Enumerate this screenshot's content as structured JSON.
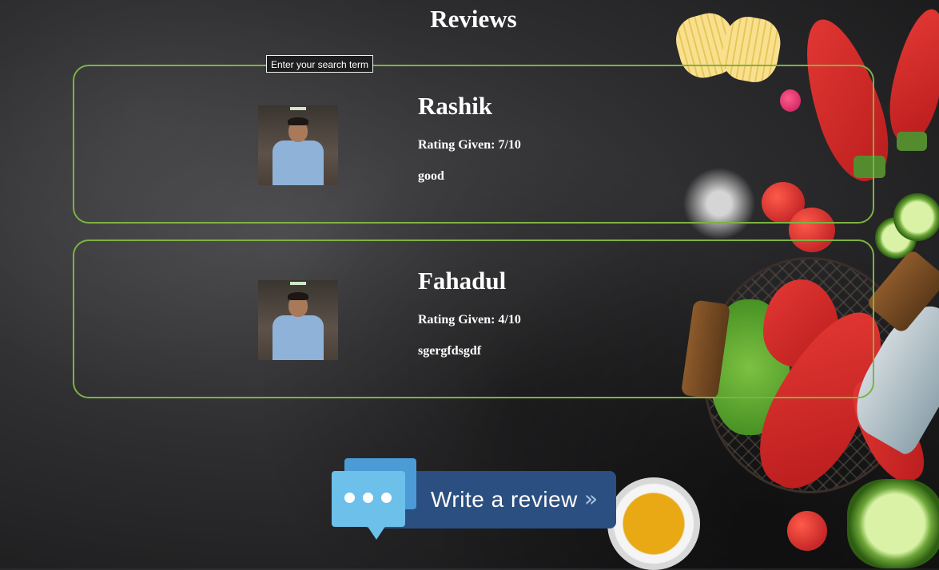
{
  "page": {
    "title": "Reviews"
  },
  "search": {
    "tooltip": "Enter your search term"
  },
  "reviews": [
    {
      "name": "Rashik",
      "rating": "Rating Given: 7/10",
      "comment": "good"
    },
    {
      "name": "Fahadul",
      "rating": "Rating Given: 4/10",
      "comment": "sgergfdsgdf"
    }
  ],
  "write_review": {
    "label": "Write a review",
    "arrow": "»"
  },
  "colors": {
    "card_border": "#7cb342",
    "button_bar": "#2b4f80",
    "bubble": "#6cc0ea"
  }
}
